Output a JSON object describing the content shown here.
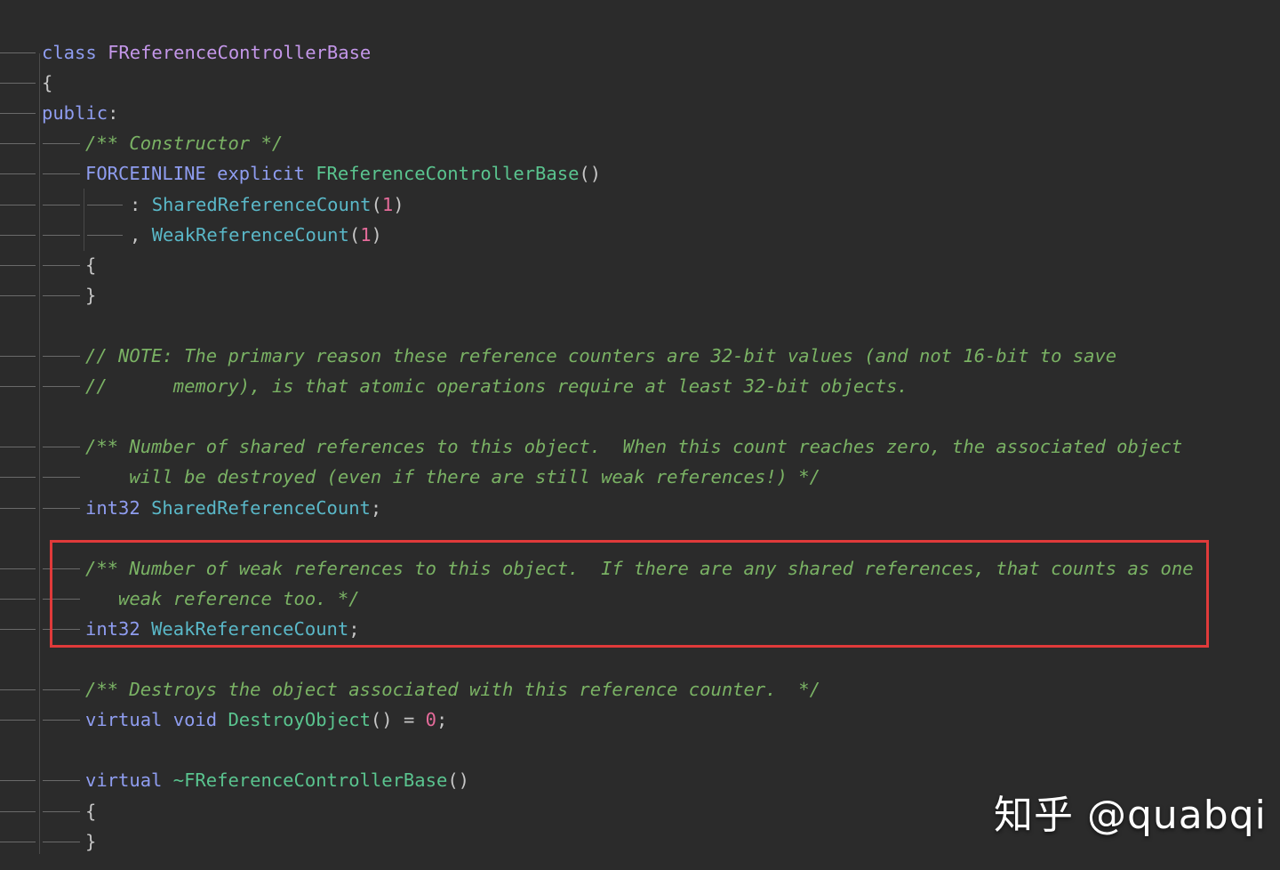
{
  "watermark": "知乎 @quabqi",
  "colors": {
    "background": "#2b2b2b",
    "keyword": "#8f9df0",
    "class_name": "#c497e9",
    "function": "#5ac48f",
    "field": "#5ab8c8",
    "number": "#e56b9a",
    "comment": "#7ab264",
    "highlight_border": "#e03a3a"
  },
  "code_lines": [
    {
      "indent": 0,
      "tokens": [
        {
          "t": "class",
          "c": "kw"
        },
        {
          "t": " ",
          "c": "sp"
        },
        {
          "t": "FReferenceControllerBase",
          "c": "cls"
        }
      ]
    },
    {
      "indent": 0,
      "tokens": [
        {
          "t": "{",
          "c": "pun"
        }
      ]
    },
    {
      "indent": 0,
      "tokens": [
        {
          "t": "public",
          "c": "kw"
        },
        {
          "t": ":",
          "c": "pun"
        }
      ]
    },
    {
      "indent": 1,
      "tokens": [
        {
          "t": "/** Constructor */",
          "c": "com"
        }
      ]
    },
    {
      "indent": 1,
      "tokens": [
        {
          "t": "FORCEINLINE",
          "c": "kw"
        },
        {
          "t": " ",
          "c": "sp"
        },
        {
          "t": "explicit",
          "c": "kw"
        },
        {
          "t": " ",
          "c": "sp"
        },
        {
          "t": "FReferenceControllerBase",
          "c": "fn"
        },
        {
          "t": "()",
          "c": "pun"
        }
      ]
    },
    {
      "indent": 2,
      "tokens": [
        {
          "t": ": ",
          "c": "pun"
        },
        {
          "t": "SharedReferenceCount",
          "c": "field"
        },
        {
          "t": "(",
          "c": "pun"
        },
        {
          "t": "1",
          "c": "num"
        },
        {
          "t": ")",
          "c": "pun"
        }
      ]
    },
    {
      "indent": 2,
      "tokens": [
        {
          "t": ", ",
          "c": "pun"
        },
        {
          "t": "WeakReferenceCount",
          "c": "field"
        },
        {
          "t": "(",
          "c": "pun"
        },
        {
          "t": "1",
          "c": "num"
        },
        {
          "t": ")",
          "c": "pun"
        }
      ]
    },
    {
      "indent": 1,
      "tokens": [
        {
          "t": "{",
          "c": "pun"
        }
      ]
    },
    {
      "indent": 1,
      "tokens": [
        {
          "t": "}",
          "c": "pun"
        }
      ]
    },
    {
      "indent": -1,
      "tokens": []
    },
    {
      "indent": 1,
      "tokens": [
        {
          "t": "// NOTE: The primary reason these reference counters are 32-bit values (and not 16-bit to save",
          "c": "com"
        }
      ]
    },
    {
      "indent": 1,
      "tokens": [
        {
          "t": "//      memory), is that atomic operations require at least 32-bit objects.",
          "c": "com"
        }
      ]
    },
    {
      "indent": -1,
      "tokens": []
    },
    {
      "indent": 1,
      "tokens": [
        {
          "t": "/** Number of shared references to this object.  When this count reaches zero, the associated object",
          "c": "com"
        }
      ]
    },
    {
      "indent": 1,
      "tokens": [
        {
          "t": "    will be destroyed (even if there are still weak references!) */",
          "c": "com"
        }
      ]
    },
    {
      "indent": 1,
      "tokens": [
        {
          "t": "int32",
          "c": "kw"
        },
        {
          "t": " ",
          "c": "sp"
        },
        {
          "t": "SharedReferenceCount",
          "c": "field"
        },
        {
          "t": ";",
          "c": "pun"
        }
      ]
    },
    {
      "indent": -1,
      "tokens": []
    },
    {
      "indent": 1,
      "tokens": [
        {
          "t": "/** Number of weak references to this object.  If there are any shared references, that counts as one",
          "c": "com"
        }
      ]
    },
    {
      "indent": 1,
      "tokens": [
        {
          "t": "   weak reference too. */",
          "c": "com"
        }
      ]
    },
    {
      "indent": 1,
      "tokens": [
        {
          "t": "int32",
          "c": "kw"
        },
        {
          "t": " ",
          "c": "sp"
        },
        {
          "t": "WeakReferenceCount",
          "c": "field"
        },
        {
          "t": ";",
          "c": "pun"
        }
      ]
    },
    {
      "indent": -1,
      "tokens": []
    },
    {
      "indent": 1,
      "tokens": [
        {
          "t": "/** Destroys the object associated with this reference counter.  */",
          "c": "com"
        }
      ]
    },
    {
      "indent": 1,
      "tokens": [
        {
          "t": "virtual",
          "c": "kw"
        },
        {
          "t": " ",
          "c": "sp"
        },
        {
          "t": "void",
          "c": "kw"
        },
        {
          "t": " ",
          "c": "sp"
        },
        {
          "t": "DestroyObject",
          "c": "fn"
        },
        {
          "t": "() = ",
          "c": "pun"
        },
        {
          "t": "0",
          "c": "num"
        },
        {
          "t": ";",
          "c": "pun"
        }
      ]
    },
    {
      "indent": -1,
      "tokens": []
    },
    {
      "indent": 1,
      "tokens": [
        {
          "t": "virtual",
          "c": "kw"
        },
        {
          "t": " ",
          "c": "sp"
        },
        {
          "t": "~FReferenceControllerBase",
          "c": "fn"
        },
        {
          "t": "()",
          "c": "pun"
        }
      ]
    },
    {
      "indent": 1,
      "tokens": [
        {
          "t": "{",
          "c": "pun"
        }
      ]
    },
    {
      "indent": 1,
      "tokens": [
        {
          "t": "}",
          "c": "pun"
        }
      ]
    }
  ]
}
